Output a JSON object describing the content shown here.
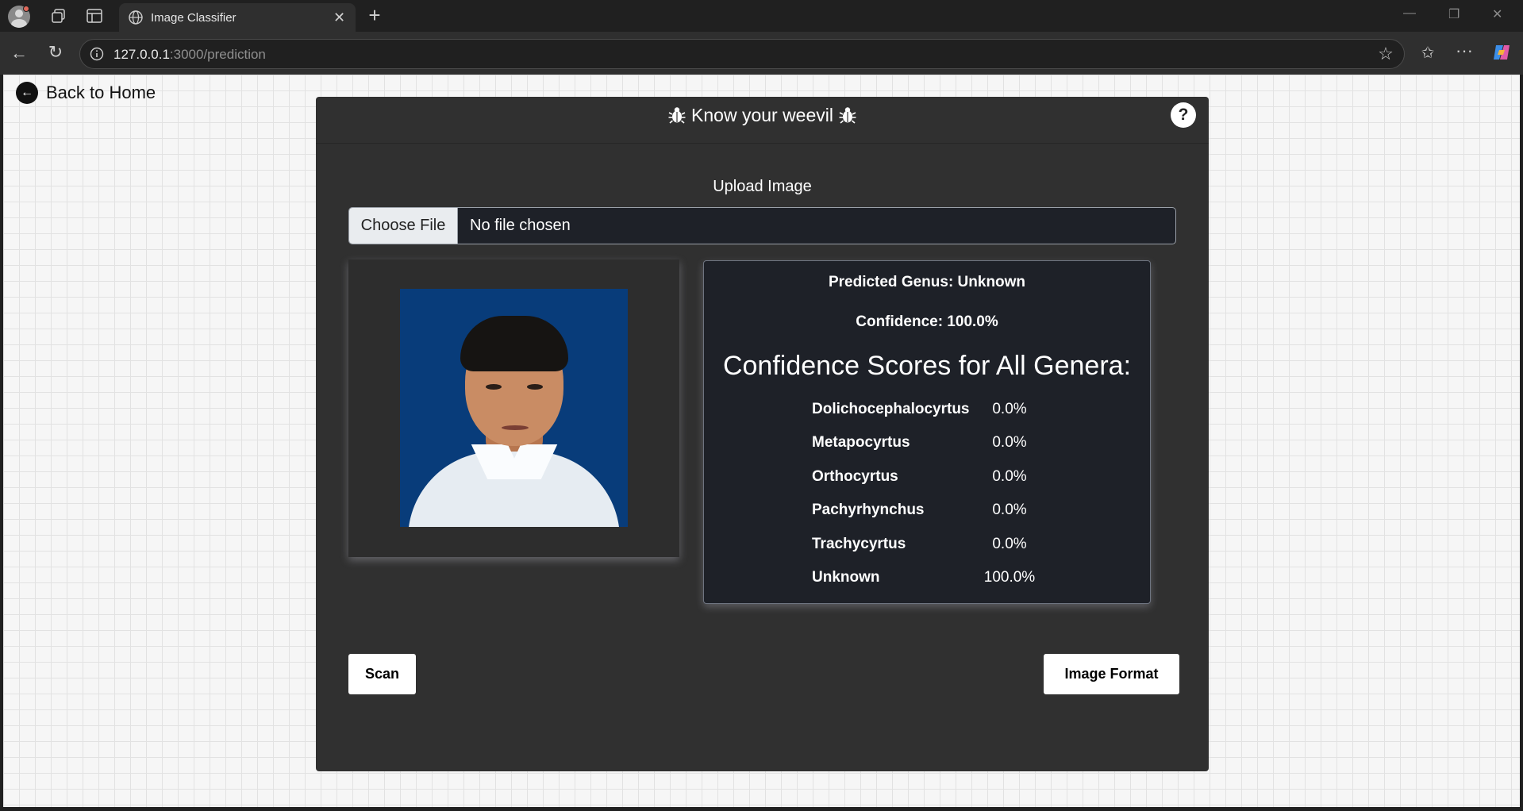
{
  "browser": {
    "tab_title": "Image Classifier",
    "url_host": "127.0.0.1",
    "url_rest": ":3000/prediction"
  },
  "page": {
    "back_label": "Back to Home",
    "title": "Know your weevil",
    "title_icon": "bug-icon",
    "help_label": "?",
    "upload_label": "Upload Image",
    "choose_file_label": "Choose File",
    "file_status": "No file chosen",
    "result": {
      "predicted_genus": "Predicted Genus: Unknown",
      "confidence": "Confidence: 100.0%",
      "scores_title": "Confidence Scores for All Genera:",
      "scores": [
        {
          "genus": "Dolichocephalocyrtus",
          "value": "0.0%"
        },
        {
          "genus": "Metapocyrtus",
          "value": "0.0%"
        },
        {
          "genus": "Orthocyrtus",
          "value": "0.0%"
        },
        {
          "genus": "Pachyrhynchus",
          "value": "0.0%"
        },
        {
          "genus": "Trachycyrtus",
          "value": "0.0%"
        },
        {
          "genus": "Unknown",
          "value": "100.0%"
        }
      ]
    },
    "scan_label": "Scan",
    "format_label": "Image Format"
  },
  "colors": {
    "card_bg": "#303030",
    "panel_bg": "#1e2128",
    "page_bg": "#f6f6f6"
  }
}
